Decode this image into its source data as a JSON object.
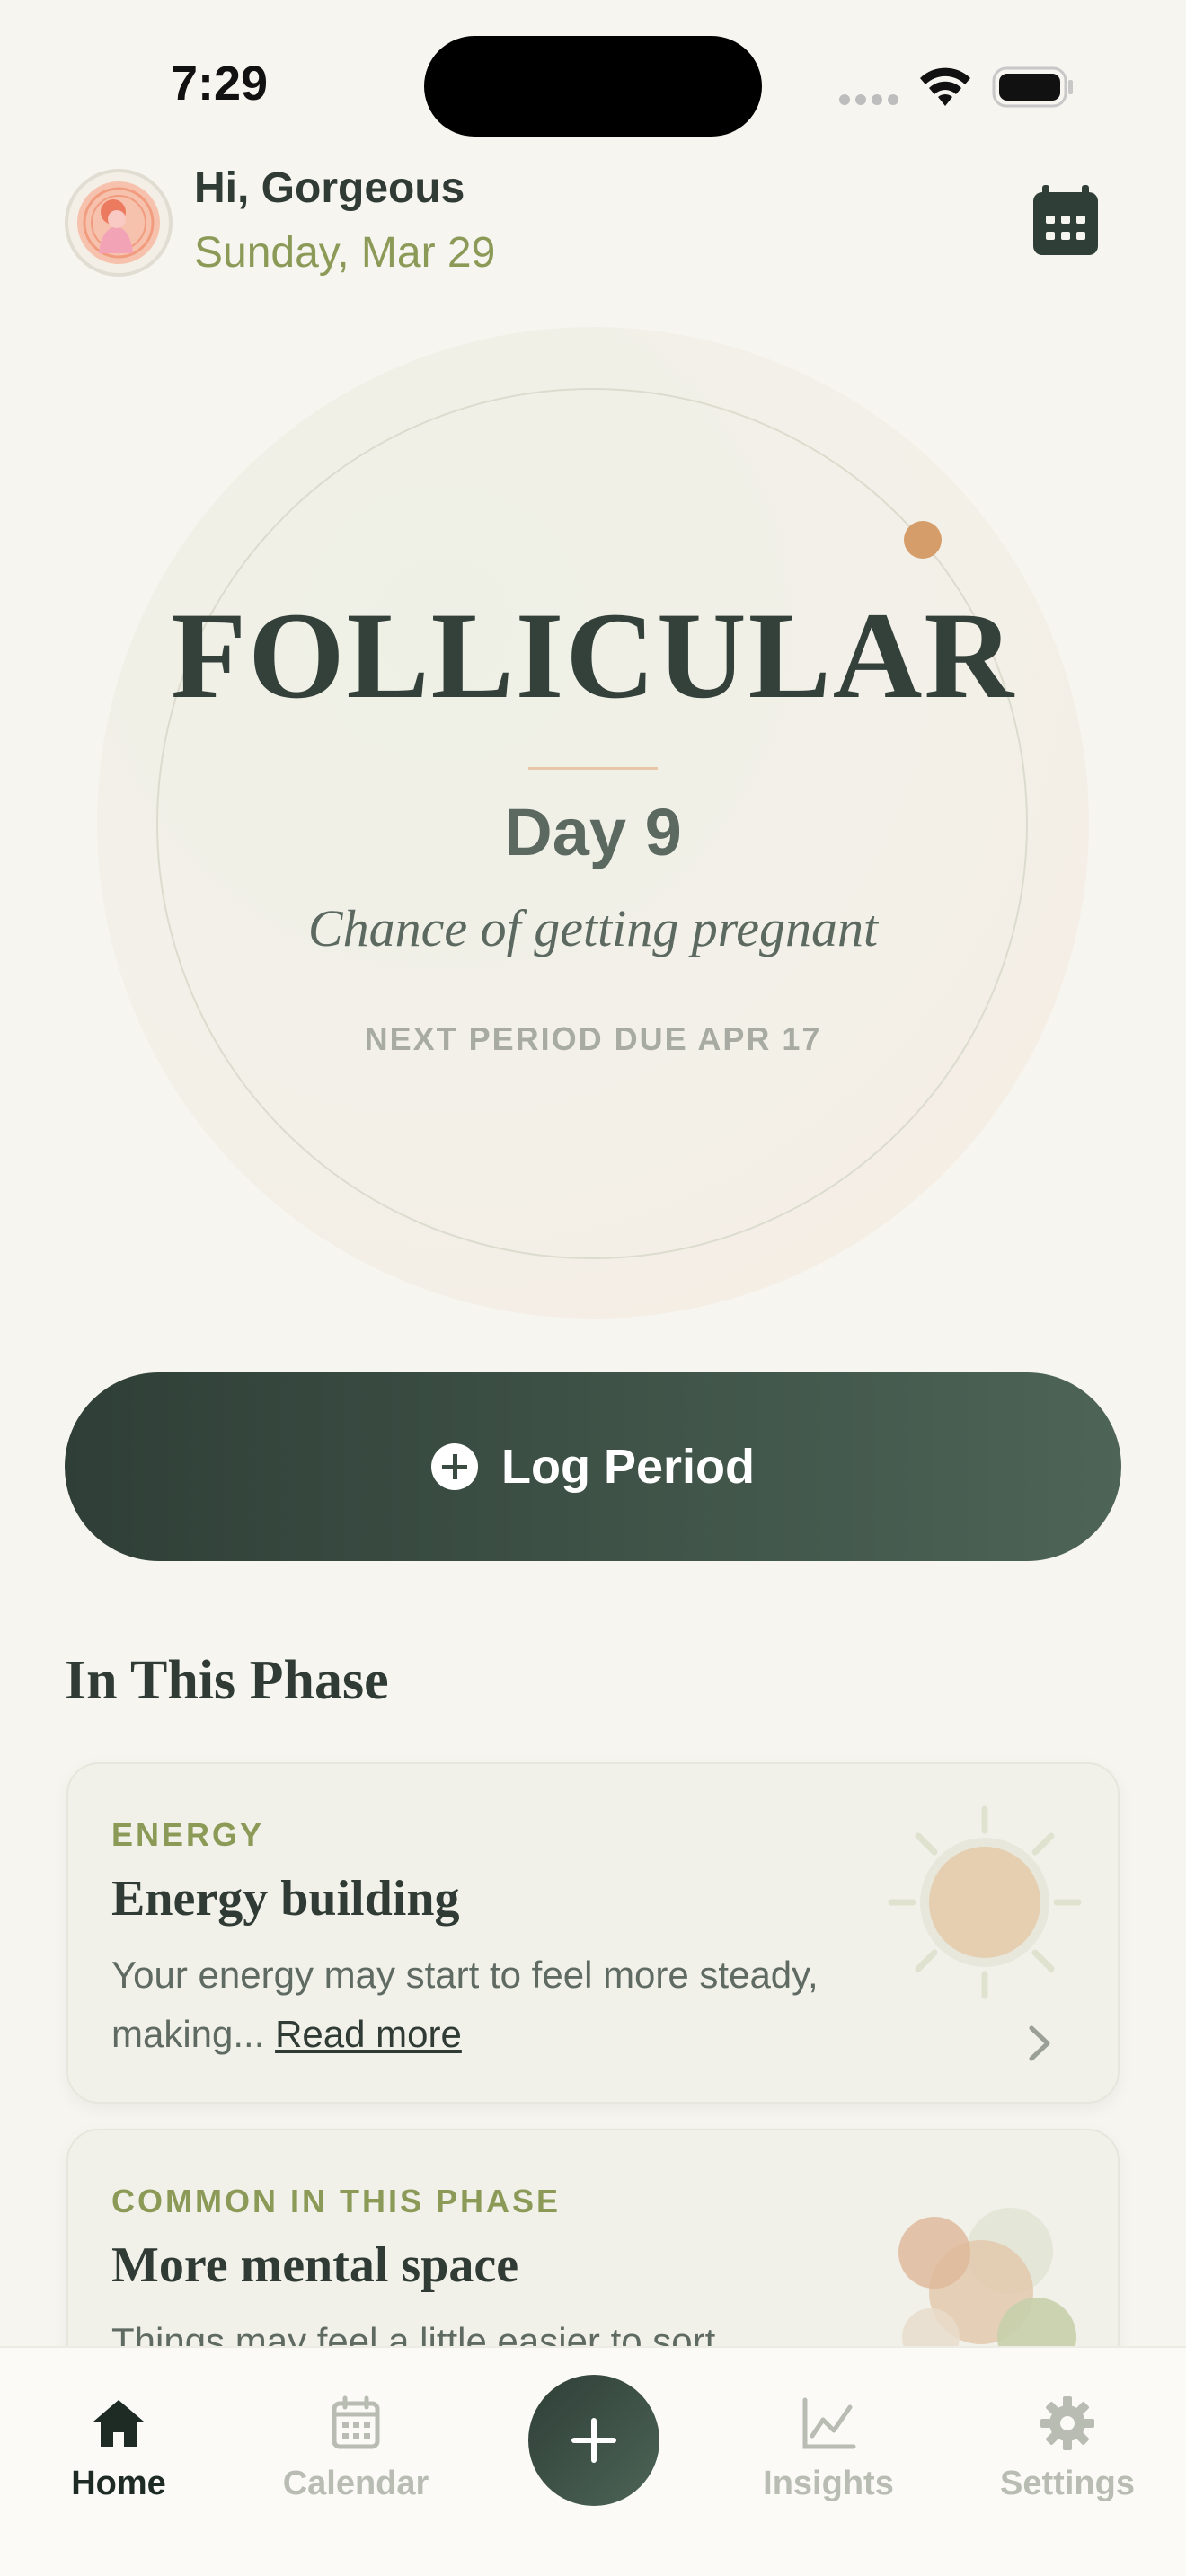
{
  "status_bar": {
    "time": "7:29"
  },
  "header": {
    "greeting": "Hi, Gorgeous",
    "date": "Sunday, Mar 29"
  },
  "hero": {
    "phase": "FOLLICULAR",
    "day": "Day 9",
    "chance_text": "Chance of getting pregnant",
    "next_period": "NEXT PERIOD DUE APR 17",
    "accent_color": "#d59d6a"
  },
  "log_button": {
    "label": "Log Period"
  },
  "section": {
    "title": "In This Phase"
  },
  "cards": [
    {
      "eyebrow": "ENERGY",
      "title": "Energy building",
      "body": "Your energy may start to feel more steady, making...",
      "read_more": "Read more",
      "icon": "sun-illustration"
    },
    {
      "eyebrow": "COMMON IN THIS PHASE",
      "title": "More mental space",
      "body": "Things may feel a little easier to sort",
      "icon": "bubbles-illustration"
    }
  ],
  "tab_bar": {
    "home": "Home",
    "calendar": "Calendar",
    "insights": "Insights",
    "settings": "Settings"
  },
  "colors": {
    "primary_dark": "#2f3f37",
    "olive": "#8c9a58",
    "background": "#f7f5f0"
  }
}
